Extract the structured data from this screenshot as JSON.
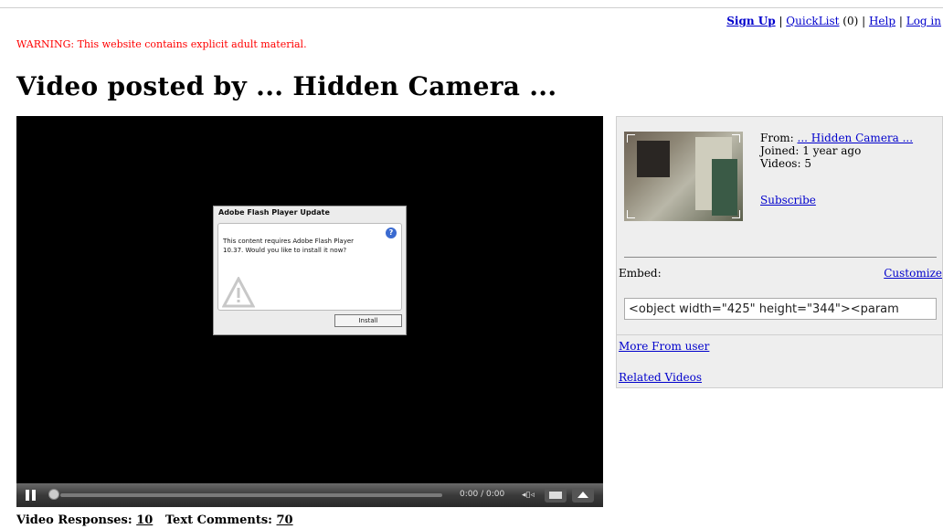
{
  "topnav": {
    "signup": "Sign Up",
    "sep1": " | ",
    "quicklist": "QuickList",
    "quicklist_count": " (0) | ",
    "help": "Help",
    "sep2": " | ",
    "login": "Log in"
  },
  "warning": "WARNING: This website contains explicit adult material.",
  "title": "Video posted by ... Hidden Camera ...",
  "player": {
    "dialog_title": "Adobe Flash Player Update",
    "dialog_message": "This content requires Adobe Flash Player 10.37. Would you like to install it now?",
    "install_label": "Install",
    "help_glyph": "?",
    "time": "0:00 / 0:00",
    "volume_glyph": "◂▯◃"
  },
  "uploader": {
    "from_label": "From: ",
    "from_name": "... Hidden Camera ...",
    "joined": "Joined: 1 year ago",
    "videos": "Videos: 5",
    "subscribe": "Subscribe"
  },
  "embed": {
    "label": "Embed:",
    "customize": "Customize",
    "code": "<object width=\"425\" height=\"344\"><param"
  },
  "side_links": {
    "more_from_user": "More From user",
    "related_videos": "Related Videos"
  },
  "responses": {
    "video_label": "Video Responses: ",
    "video_count": "10",
    "text_label": "Text Comments: ",
    "text_count": "70"
  },
  "colors": {
    "link": "#0000cc",
    "warning": "#ff0000",
    "panel": "#eeeeee"
  }
}
